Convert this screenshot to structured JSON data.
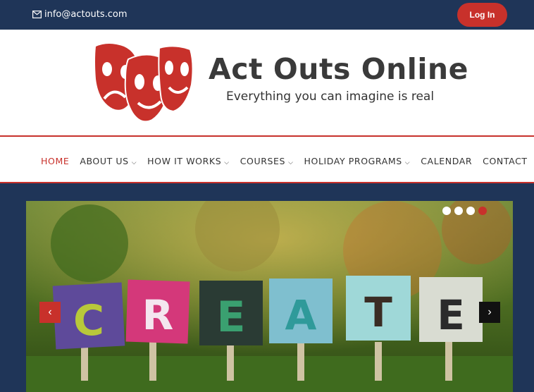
{
  "topbar": {
    "email": "info@actouts.com",
    "login_label": "Log In",
    "email_icon": "envelope-icon"
  },
  "brand": {
    "name": "Act Outs Online",
    "tagline": "Everything you can imagine is real",
    "logo_icon": "theatre-masks-icon"
  },
  "nav": {
    "items": [
      {
        "label": "HOME",
        "active": true
      },
      {
        "label": "ABOUT US",
        "dropdown": true
      },
      {
        "label": "HOW IT WORKS",
        "dropdown": true
      },
      {
        "label": "COURSES",
        "dropdown": true
      },
      {
        "label": "HOLIDAY PROGRAMS",
        "dropdown": true
      },
      {
        "label": "CALENDAR"
      },
      {
        "label": "CONTACT"
      }
    ]
  },
  "slider": {
    "dots": 4,
    "active_dot": 4,
    "letters": [
      "C",
      "R",
      "E",
      "A",
      "T",
      "E"
    ],
    "prev_icon": "chevron-left-icon",
    "next_icon": "chevron-right-icon"
  },
  "colors": {
    "navy": "#1f3558",
    "accent_red": "#c8312b"
  }
}
